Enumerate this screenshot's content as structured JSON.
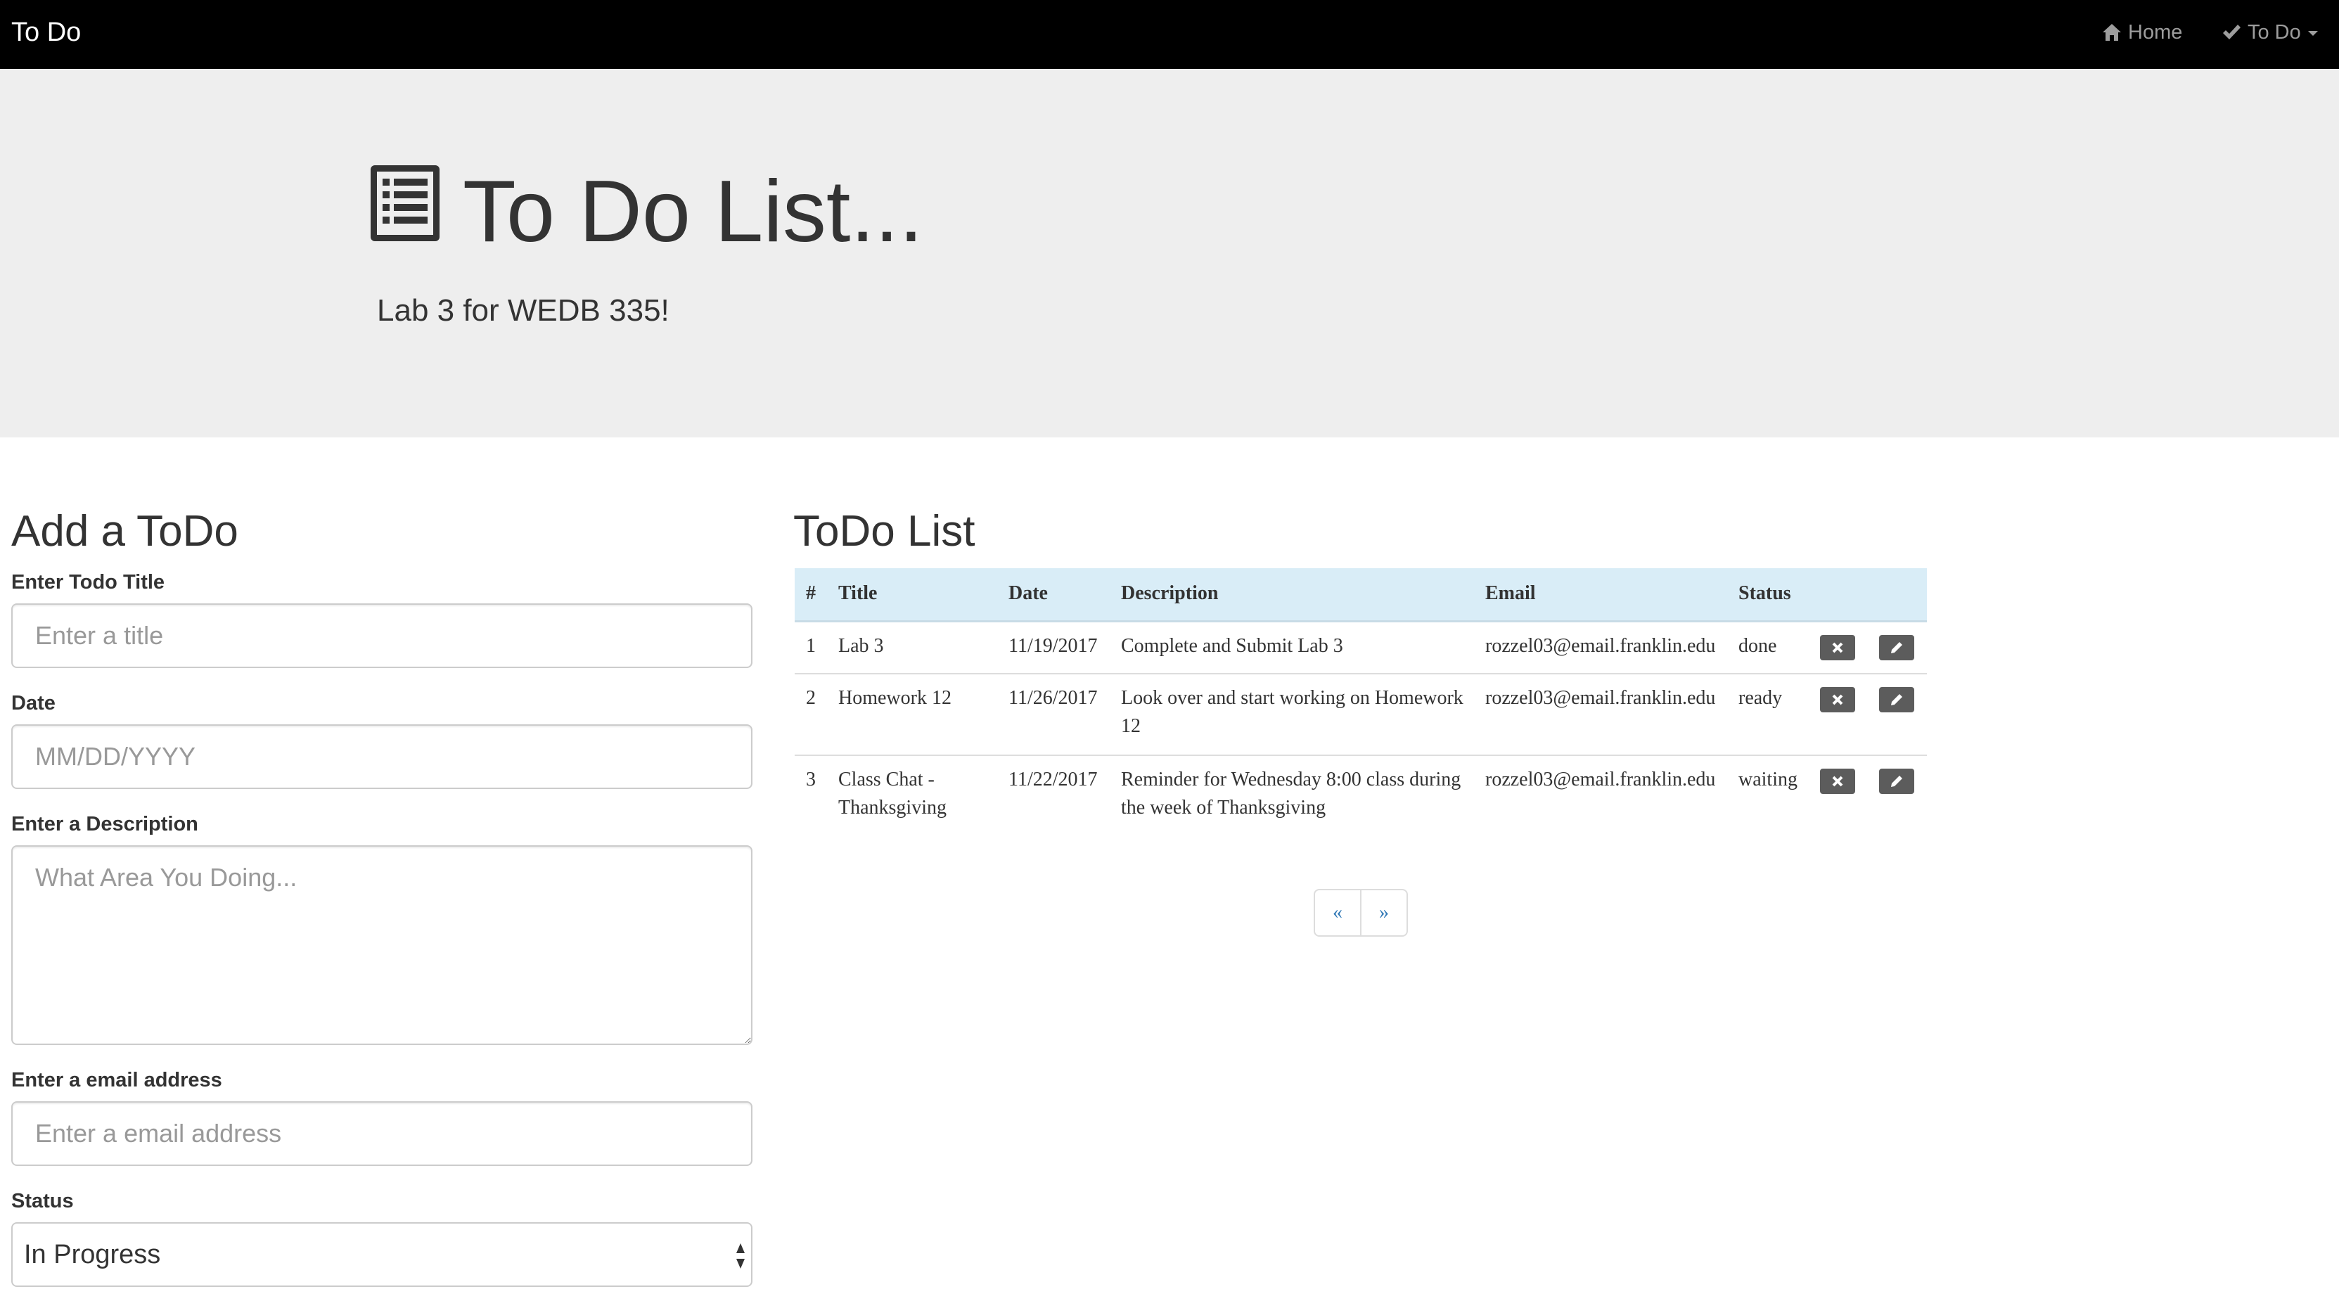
{
  "navbar": {
    "brand": "To Do",
    "home_label": "Home",
    "todo_label": "To Do",
    "home_icon": "home-icon",
    "todo_icon": "checkmark-icon"
  },
  "jumbotron": {
    "title": "To Do List...",
    "subtitle": "Lab 3 for WEDB 335!",
    "icon": "list-icon"
  },
  "form": {
    "heading": "Add a ToDo",
    "title_label": "Enter Todo Title",
    "title_placeholder": "Enter a title",
    "date_label": "Date",
    "date_placeholder": "MM/DD/YYYY",
    "description_label": "Enter a Description",
    "description_placeholder": "What Area You Doing...",
    "email_label": "Enter a email address",
    "email_placeholder": "Enter a email address",
    "status_label": "Status",
    "status_value": "In Progress"
  },
  "todo_list": {
    "heading": "ToDo List",
    "columns": [
      "#",
      "Title",
      "Date",
      "Description",
      "Email",
      "Status"
    ],
    "rows": [
      {
        "num": "1",
        "title": "Lab 3",
        "date": "11/19/2017",
        "description": "Complete and Submit Lab 3",
        "email": "rozzel03@email.franklin.edu",
        "status": "done"
      },
      {
        "num": "2",
        "title": "Homework 12",
        "date": "11/26/2017",
        "description": "Look over and start working on Homework 12",
        "email": "rozzel03@email.franklin.edu",
        "status": "ready"
      },
      {
        "num": "3",
        "title": "Class Chat - Thanksgiving",
        "date": "11/22/2017",
        "description": "Reminder for Wednesday 8:00 class during the week of Thanksgiving",
        "email": "rozzel03@email.franklin.edu",
        "status": "waiting"
      }
    ],
    "delete_icon": "remove-icon",
    "edit_icon": "pencil-icon"
  },
  "pagination": {
    "prev": "«",
    "next": "»"
  },
  "colors": {
    "navbar_bg": "#000000",
    "jumbotron_bg": "#eeeeee",
    "table_header_bg": "#d9edf7",
    "action_button_bg": "#5c5c5c",
    "link_color": "#337ab7"
  }
}
